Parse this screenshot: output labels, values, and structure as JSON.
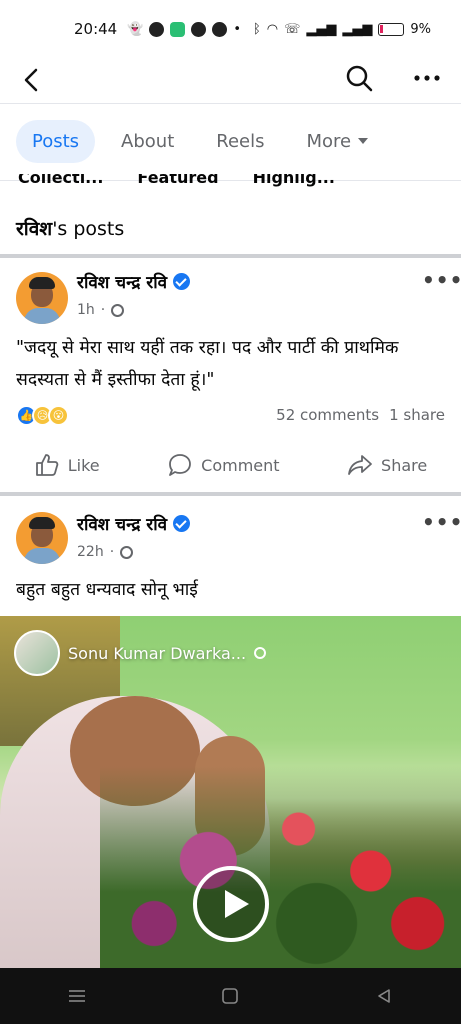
{
  "status_bar": {
    "time": "20:44",
    "battery": "9%",
    "icons": [
      "snapchat-icon",
      "facebook-icon",
      "app-icon",
      "messenger-icon",
      "a-icon",
      "bluetooth-icon",
      "wifi-icon",
      "call-icon",
      "signal-icon",
      "signal-icon",
      "battery-icon"
    ]
  },
  "tabs": [
    {
      "label": "Posts",
      "active": true
    },
    {
      "label": "About"
    },
    {
      "label": "Reels"
    },
    {
      "label": "More"
    }
  ],
  "subtabs": [
    "Collecti...",
    "Featured",
    "Highlig..."
  ],
  "posts_heading": {
    "bold": "रविश",
    "rest": "'s posts"
  },
  "posts": [
    {
      "author": "रविश चन्द्र रवि",
      "time": "1h",
      "text": "\"जदयू से मेरा साथ यहीं तक रहा। पद और पार्टी की प्राथमिक सदस्यता से मैं इस्तीफा देता हूं।\"",
      "comments": "52 comments",
      "shares": "1 share"
    },
    {
      "author": "रविश चन्द्र रवि",
      "time": "22h",
      "text": "बहुत बहुत धन्यवाद सोनू भाई",
      "shared_from": "Sonu Kumar Dwarka..."
    }
  ],
  "actions": {
    "like": "Like",
    "comment": "Comment",
    "share": "Share"
  },
  "colors": {
    "accent": "#1877f2",
    "tab_active_bg": "#e7f0fd",
    "muted": "#65676b"
  }
}
